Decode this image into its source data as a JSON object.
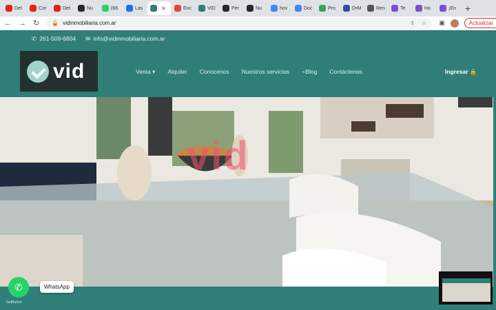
{
  "browser": {
    "tabs": [
      {
        "label": "Det",
        "favicon": "youtube-icon",
        "color": "#e62117"
      },
      {
        "label": "Cor",
        "favicon": "youtube-icon",
        "color": "#e62117"
      },
      {
        "label": "Det",
        "favicon": "youtube-icon",
        "color": "#e62117"
      },
      {
        "label": "Nu",
        "favicon": "github-icon",
        "color": "#24292e"
      },
      {
        "label": "(66",
        "favicon": "whatsapp-icon",
        "color": "#25d366"
      },
      {
        "label": "Las",
        "favicon": "info-icon",
        "color": "#1a73e8"
      },
      {
        "label": "",
        "favicon": "vid-icon",
        "color": "#2f7f78",
        "active": true
      },
      {
        "label": "Enc",
        "favicon": "z-icon",
        "color": "#e8453c"
      },
      {
        "label": "VID",
        "favicon": "vid-icon",
        "color": "#2f7f78"
      },
      {
        "label": "Per",
        "favicon": "github-icon",
        "color": "#24292e"
      },
      {
        "label": "Nu",
        "favicon": "github-icon",
        "color": "#24292e"
      },
      {
        "label": "hov",
        "favicon": "google-icon",
        "color": "#4285f4"
      },
      {
        "label": "Doc",
        "favicon": "docs-icon",
        "color": "#4285f4"
      },
      {
        "label": "Pro",
        "favicon": "circle-icon",
        "color": "#34a853"
      },
      {
        "label": "D•M",
        "favicon": "dm-icon",
        "color": "#3c4a9c"
      },
      {
        "label": "Ren",
        "favicon": "swoosh-icon",
        "color": "#555555"
      },
      {
        "label": "Te",
        "favicon": "h-icon",
        "color": "#7b4fc9"
      },
      {
        "label": "Ho",
        "favicon": "h-icon",
        "color": "#7b4fc9"
      },
      {
        "label": "¡En",
        "favicon": "h-icon",
        "color": "#7b4fc9"
      }
    ],
    "new_tab": "+",
    "address": "vidinmobiliaria.com.ar",
    "update_label": "Actualizar"
  },
  "site": {
    "phone": "261-509-6804",
    "email": "info@vidinmobiliaria.com.ar",
    "logo_text": "vid",
    "nav": [
      "Venta ▾",
      "Alquiler",
      "Conocenos",
      "Nuestros servicios",
      "Blog",
      "Contáctenos"
    ],
    "login": "Ingresar",
    "hero_watermark": "vid"
  },
  "widgets": {
    "whatsapp_label": "WhatsApp",
    "credit": "GetButton"
  },
  "colors": {
    "brand": "#2f7f78",
    "logo_bg": "#24302f",
    "watermark": "#f0506e"
  }
}
